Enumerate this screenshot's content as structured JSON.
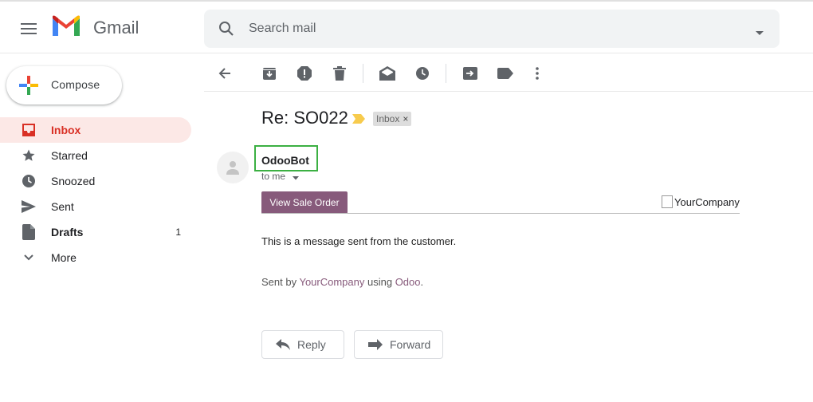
{
  "header": {
    "app_name": "Gmail",
    "search_placeholder": "Search mail"
  },
  "sidebar": {
    "compose_label": "Compose",
    "items": [
      {
        "label": "Inbox",
        "icon": "inbox-icon",
        "active": true,
        "bold": true,
        "count": ""
      },
      {
        "label": "Starred",
        "icon": "star-icon",
        "count": ""
      },
      {
        "label": "Snoozed",
        "icon": "clock-icon",
        "count": ""
      },
      {
        "label": "Sent",
        "icon": "send-icon",
        "count": ""
      },
      {
        "label": "Drafts",
        "icon": "draft-icon",
        "bold": true,
        "count": "1"
      },
      {
        "label": "More",
        "icon": "chevron-down-icon",
        "count": ""
      }
    ]
  },
  "toolbar": {
    "icons": [
      "back-arrow-icon",
      "archive-icon",
      "report-spam-icon",
      "delete-icon",
      "mark-unread-icon",
      "snooze-icon",
      "move-to-icon",
      "label-icon",
      "more-vert-icon"
    ]
  },
  "message": {
    "subject": "Re: SO022",
    "label_chip": "Inbox",
    "label_chip_close": "×",
    "sender": "OdooBot",
    "recipient": "to me",
    "sale_button": "View Sale Order",
    "company_image_alt": "YourCompany",
    "body": "This is a message sent from the customer.",
    "sent_by_prefix": "Sent by ",
    "sent_by_company": "YourCompany",
    "sent_by_middle": " using ",
    "sent_by_platform": "Odoo",
    "sent_by_suffix": "."
  },
  "actions": {
    "reply": "Reply",
    "forward": "Forward"
  },
  "colors": {
    "gmail_red": "#d93025",
    "inbox_active_bg": "#fce8e6",
    "odoo_purple": "#875a7b",
    "highlight_green": "#3cb043"
  }
}
